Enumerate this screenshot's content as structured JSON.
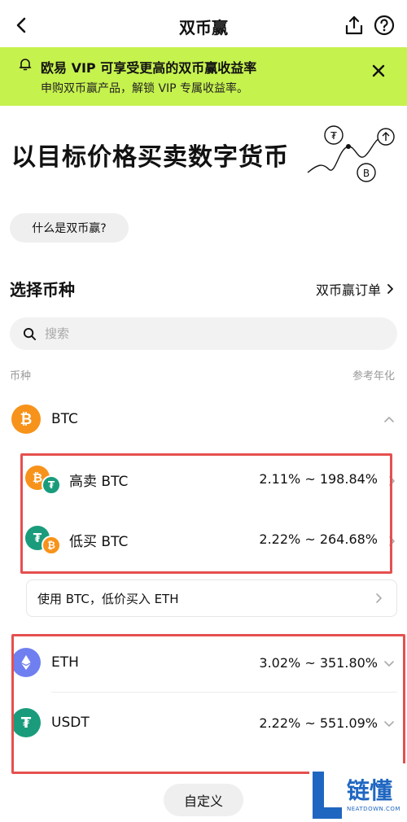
{
  "header": {
    "title": "双币赢"
  },
  "banner": {
    "title": "欧易 VIP 可享受更高的双币赢收益率",
    "subtitle": "申购双币赢产品，解锁 VIP 专属收益率。"
  },
  "hero": {
    "title": "以目标价格买卖数字货币"
  },
  "what_button": "什么是双币赢?",
  "select_section": {
    "title": "选择币种",
    "orders_link": "双币赢订单"
  },
  "search": {
    "placeholder": "搜索"
  },
  "columns": {
    "left": "币种",
    "right": "参考年化"
  },
  "coins": [
    {
      "name": "BTC",
      "rate": "",
      "color": "#f7931a",
      "icon": "bitcoin-icon",
      "expanded": true
    },
    {
      "name": "ETH",
      "rate": "3.02% ~ 351.80%",
      "color": "#6f7ff0",
      "icon": "ethereum-icon",
      "expanded": false
    },
    {
      "name": "USDT",
      "rate": "2.22% ~ 551.09%",
      "color": "#1a9c7c",
      "icon": "tether-icon",
      "expanded": false
    }
  ],
  "btc_products": [
    {
      "label": "高卖 BTC",
      "rate": "2.11% ~ 198.84%"
    },
    {
      "label": "低买 BTC",
      "rate": "2.22% ~ 264.68%"
    }
  ],
  "btc_to_eth": "使用 BTC，低价买入 ETH",
  "custom_button": "自定义",
  "watermark": {
    "text": "链懂",
    "sub": "NEATDOWN.COM"
  },
  "colors": {
    "banner": "#c6f24e",
    "highlight_box": "#e5504f",
    "btc": "#f7931a",
    "usdt": "#1a9c7c",
    "eth": "#6f7ff0"
  }
}
